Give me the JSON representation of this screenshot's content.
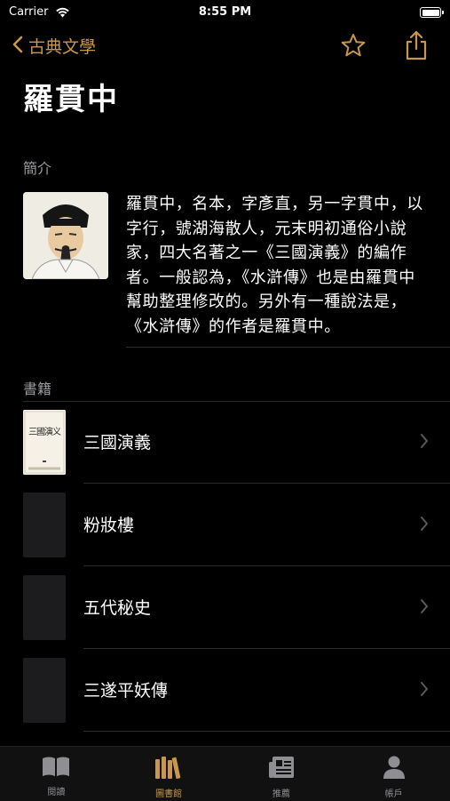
{
  "status_bar": {
    "carrier": "Carrier",
    "time": "8:55 PM"
  },
  "nav": {
    "back_label": "古典文學"
  },
  "author": {
    "name": "羅貫中",
    "intro_header": "簡介",
    "intro_text": "羅貫中，名本，字彥直，另一字貫中，以字行，號湖海散人，元末明初通俗小說家，四大名著之一《三國演義》的編作者。一般認為，《水滸傳》也是由羅貫中幫助整理修改的。另外有一種說法是，《水滸傳》的作者是羅貫中。"
  },
  "books": {
    "header": "書籍",
    "items": [
      {
        "title": "三國演義",
        "has_cover": true,
        "cover_text": "三國演义"
      },
      {
        "title": "粉妝樓",
        "has_cover": false
      },
      {
        "title": "五代秘史",
        "has_cover": false
      },
      {
        "title": "三遂平妖傳",
        "has_cover": false
      }
    ]
  },
  "tabs": [
    {
      "label": "閱讀",
      "icon": "book-open-icon",
      "active": false
    },
    {
      "label": "圖書館",
      "icon": "library-icon",
      "active": true
    },
    {
      "label": "推薦",
      "icon": "news-icon",
      "active": false
    },
    {
      "label": "帳戶",
      "icon": "person-icon",
      "active": false
    }
  ],
  "colors": {
    "accent": "#c9974b",
    "background": "#000000",
    "separator": "#2a2a2c",
    "secondary_text": "#9a9a9f"
  }
}
